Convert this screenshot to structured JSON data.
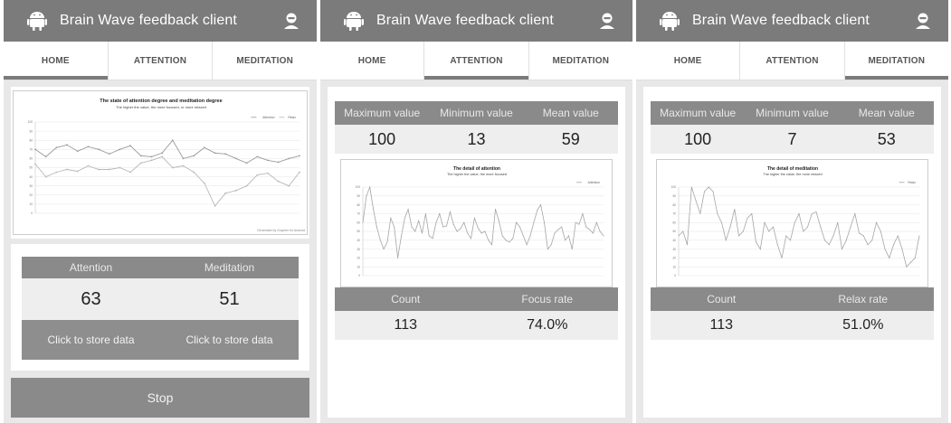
{
  "app": {
    "title": "Brain Wave feedback client"
  },
  "tabs": [
    "HOME",
    "ATTENTION",
    "MEDITATION"
  ],
  "colors": {
    "appbar": "#7b7b7b",
    "stat_header": "#8a8a8a",
    "line": "#aaaaaa"
  },
  "home": {
    "chart": {
      "title": "The state of attention degree and meditation degree",
      "subtitle": "The higher the value, the more focused, or more relaxed",
      "legend": [
        "Attention",
        "Relax"
      ],
      "credit": "Generated by Grapher for Android"
    },
    "readout": {
      "attention_label": "Attention",
      "meditation_label": "Meditation",
      "attention_value": "63",
      "meditation_value": "51",
      "store_attention": "Click to store data",
      "store_meditation": "Click to store data"
    },
    "stop_label": "Stop"
  },
  "attention": {
    "stats": {
      "max_label": "Maximum value",
      "min_label": "Minimum value",
      "mean_label": "Mean value",
      "max": "100",
      "min": "13",
      "mean": "59"
    },
    "chart": {
      "title": "The detail of attention",
      "subtitle": "The higher the value, the more focused",
      "legend": "Attention"
    },
    "summary": {
      "count_label": "Count",
      "rate_label": "Focus rate",
      "count": "113",
      "rate": "74.0%"
    }
  },
  "meditation": {
    "stats": {
      "max_label": "Maximum value",
      "min_label": "Minimum value",
      "mean_label": "Mean value",
      "max": "100",
      "min": "7",
      "mean": "53"
    },
    "chart": {
      "title": "The detail of meditation",
      "subtitle": "The higher the value, the more relaxed",
      "legend": "Relax"
    },
    "summary": {
      "count_label": "Count",
      "rate_label": "Relax rate",
      "count": "113",
      "rate": "51.0%"
    }
  },
  "chart_data": [
    {
      "type": "line",
      "title": "The state of attention degree and meditation degree",
      "subtitle": "The higher the value, the more focused, or more relaxed",
      "ylim": [
        0,
        100
      ],
      "yticks": [
        0,
        10,
        20,
        30,
        40,
        50,
        60,
        70,
        80,
        90,
        100
      ],
      "grid": true,
      "legend_position": "top-right",
      "series": [
        {
          "name": "Attention",
          "values": [
            70,
            62,
            72,
            75,
            68,
            73,
            70,
            65,
            70,
            74,
            63,
            62,
            66,
            80,
            60,
            63,
            72,
            66,
            65,
            60,
            55,
            62,
            58,
            56,
            60,
            63
          ]
        },
        {
          "name": "Relax",
          "values": [
            54,
            40,
            45,
            48,
            46,
            52,
            48,
            48,
            50,
            45,
            55,
            58,
            62,
            50,
            52,
            45,
            33,
            8,
            22,
            25,
            30,
            42,
            44,
            35,
            30,
            45
          ]
        }
      ]
    },
    {
      "type": "line",
      "title": "The detail of attention",
      "subtitle": "The higher the value, the more focused",
      "ylim": [
        0,
        100
      ],
      "yticks": [
        0,
        10,
        20,
        30,
        40,
        50,
        60,
        70,
        80,
        90,
        100
      ],
      "grid": true,
      "legend_position": "top-right",
      "series": [
        {
          "name": "Attention",
          "values": [
            60,
            90,
            100,
            75,
            55,
            40,
            30,
            38,
            65,
            55,
            20,
            44,
            65,
            75,
            55,
            50,
            62,
            48,
            70,
            45,
            42,
            60,
            70,
            55,
            56,
            72,
            58,
            50,
            53,
            60,
            48,
            42,
            65,
            54,
            48,
            50,
            40,
            35,
            75,
            62,
            45,
            40,
            38,
            42,
            60,
            55,
            45,
            35,
            45,
            60,
            74,
            80,
            60,
            30,
            35,
            48,
            52,
            55,
            40,
            45,
            30,
            60,
            58,
            70,
            55,
            52,
            48,
            60,
            50,
            45
          ]
        }
      ]
    },
    {
      "type": "line",
      "title": "The detail of meditation",
      "subtitle": "The higher the value, the more relaxed",
      "ylim": [
        0,
        100
      ],
      "yticks": [
        0,
        10,
        20,
        30,
        40,
        50,
        60,
        70,
        80,
        90,
        100
      ],
      "grid": true,
      "legend_position": "top-right",
      "series": [
        {
          "name": "Relax",
          "values": [
            45,
            50,
            35,
            100,
            85,
            70,
            95,
            100,
            95,
            70,
            60,
            40,
            55,
            75,
            45,
            50,
            65,
            70,
            38,
            30,
            60,
            50,
            55,
            35,
            20,
            45,
            40,
            60,
            70,
            50,
            55,
            70,
            72,
            55,
            40,
            35,
            45,
            60,
            30,
            40,
            55,
            70,
            48,
            45,
            35,
            40,
            60,
            50,
            30,
            20,
            35,
            45,
            30,
            10,
            15,
            20,
            45
          ]
        }
      ]
    }
  ]
}
